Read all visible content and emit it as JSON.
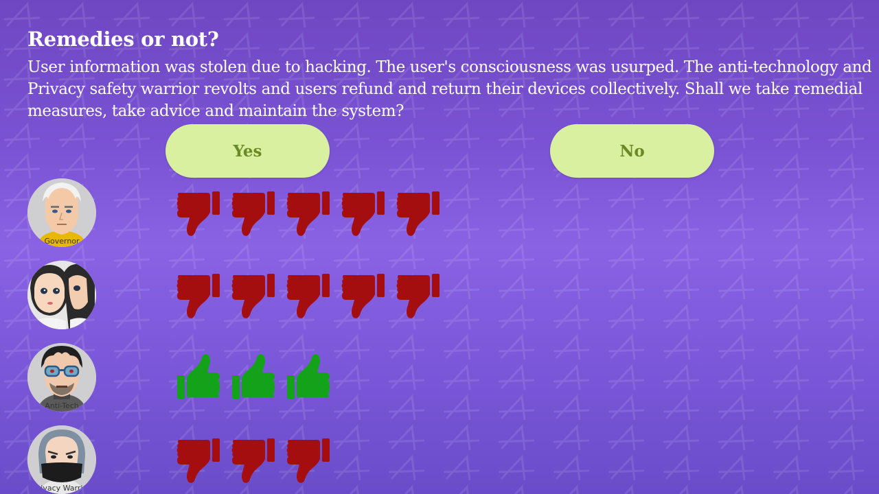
{
  "question": {
    "title": "Remedies or not?",
    "description": "User information was stolen due to hacking. The user's consciousness was usurped. The anti-technology and Privacy safety warrior revolts and users refund and return their devices collectively. Shall we take remedial measures, take advice and maintain the system?"
  },
  "choices": {
    "yes_label": "Yes",
    "no_label": "No"
  },
  "colors": {
    "background": "#7a53d4",
    "button": "#d9f0a1",
    "button_text": "#6a8a26",
    "thumbs_down": "#a50e0e",
    "thumbs_up": "#15a21b"
  },
  "advisors": [
    {
      "label": "Governor",
      "vote": "thumbs-down",
      "count": 5
    },
    {
      "label": "",
      "vote": "thumbs-down",
      "count": 5
    },
    {
      "label": "Anti-Tech",
      "vote": "thumbs-up",
      "count": 3
    },
    {
      "label": "Privacy Warrior",
      "vote": "thumbs-down",
      "count": 3
    }
  ]
}
